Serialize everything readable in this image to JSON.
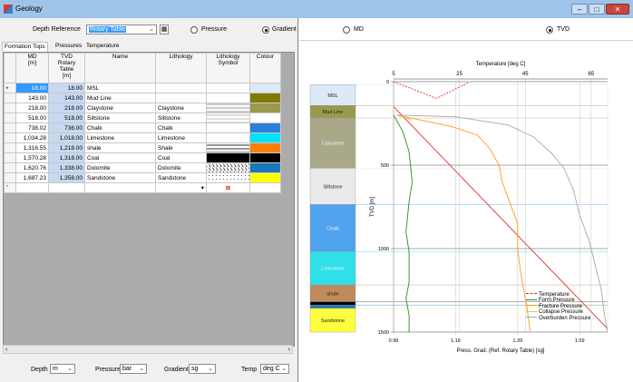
{
  "window": {
    "title": "Geology",
    "btn_min": "–",
    "btn_max": "□",
    "btn_close": "✕"
  },
  "toolbar": {
    "depth_ref_label": "Depth Reference",
    "depth_ref_value": "Rotary Table",
    "pressure_label": "Pressure",
    "gradient_label": "Gradient",
    "md_label": "MD",
    "tvd_label": "TVD"
  },
  "tabs": [
    "Formation Tops",
    "Pressures",
    "Temperature"
  ],
  "table": {
    "headers": [
      "MD\n[m]",
      "TVD\nRotary\nTable\n[m]",
      "Name",
      "Lithology",
      "Lithology\nSymbol",
      "Colour"
    ],
    "rows": [
      {
        "md": "18.00",
        "tvd": "18.00",
        "name": "MSL",
        "lith": "",
        "color": "#dbe9f8",
        "pattern": ""
      },
      {
        "md": "143.00",
        "tvd": "143.00",
        "name": "Mud Line",
        "lith": "",
        "color": "#807a00",
        "pattern": ""
      },
      {
        "md": "218.00",
        "tvd": "218.00",
        "name": "Claystone",
        "lith": "Claystone",
        "color": "#9a9a4c",
        "pattern": "clay"
      },
      {
        "md": "518.00",
        "tvd": "518.00",
        "name": "Siltstone",
        "lith": "Siltstone",
        "color": "#ffffff",
        "pattern": "silt"
      },
      {
        "md": "738.02",
        "tvd": "736.00",
        "name": "Chalk",
        "lith": "Chalk",
        "color": "#2c7fd8",
        "pattern": "chalk"
      },
      {
        "md": "1,034.28",
        "tvd": "1,018.00",
        "name": "Limestone",
        "lith": "Limestone",
        "color": "#00e0ff",
        "pattern": "lime"
      },
      {
        "md": "1,316.55",
        "tvd": "1,218.00",
        "name": "shale",
        "lith": "Shale",
        "color": "#ff8000",
        "pattern": "shale"
      },
      {
        "md": "1,570.28",
        "tvd": "1,318.00",
        "name": "Coal",
        "lith": "Coal",
        "color": "#000000",
        "pattern": "coal"
      },
      {
        "md": "1,620.76",
        "tvd": "1,338.00",
        "name": "Dolomite",
        "lith": "Dolomite",
        "color": "#1878b8",
        "pattern": "dolo"
      },
      {
        "md": "1,687.23",
        "tvd": "1,358.00",
        "name": "Sandstone",
        "lith": "Sandstone",
        "color": "#ffff00",
        "pattern": "sand"
      }
    ],
    "new_row_marker": "*",
    "current_row_marker": "▸"
  },
  "units": {
    "depth_label": "Depth",
    "depth_value": "m",
    "pressure_label": "Pressure",
    "pressure_value": "bar",
    "gradient_label": "Gradient",
    "gradient_value": "sg",
    "temp_label": "Temp",
    "temp_value": "deg C"
  },
  "chart_data": {
    "type": "line",
    "top_axis_label": "Temperature [deg C]",
    "top_ticks": [
      "5",
      "25",
      "45",
      "65"
    ],
    "top_range": [
      5,
      70
    ],
    "xlabel": "Press. Grad. (Ref. Rotary Table) [sg]",
    "x_ticks": [
      "0.99",
      "1.19",
      "1.39",
      "1.59"
    ],
    "x_range": [
      0.99,
      1.68
    ],
    "ylabel": "TVD [m]",
    "y_ticks": [
      "0",
      "500",
      "1000",
      "1500"
    ],
    "y_range": [
      0,
      1500
    ],
    "legend": [
      "Temperature",
      "Form.Pressure",
      "Fracture Pressure",
      "Collapse Pressure",
      "Overburden Pressure"
    ],
    "formations": [
      {
        "name": "MSL",
        "top": 18,
        "base": 143,
        "color": "#dbe9f8",
        "label": true
      },
      {
        "name": "Mud Line",
        "top": 143,
        "base": 218,
        "color": "#9a9a4c",
        "label": true
      },
      {
        "name": "Claystone",
        "top": 218,
        "base": 518,
        "color": "#a9a98a",
        "label": true
      },
      {
        "name": "Siltstone",
        "top": 518,
        "base": 736,
        "color": "#eaeaea",
        "label": true
      },
      {
        "name": "Chalk",
        "top": 736,
        "base": 1018,
        "color": "#4fa3ef",
        "label": true
      },
      {
        "name": "Limestone",
        "top": 1018,
        "base": 1218,
        "color": "#2fe0e8",
        "label": true
      },
      {
        "name": "shale",
        "top": 1218,
        "base": 1318,
        "color": "#c08a5a",
        "label": true
      },
      {
        "name": "Coal",
        "top": 1318,
        "base": 1338,
        "color": "#000000",
        "label": false
      },
      {
        "name": "Dolomite",
        "top": 1338,
        "base": 1358,
        "color": "#1878b8",
        "label": false
      },
      {
        "name": "Sandstone",
        "top": 1358,
        "base": 1500,
        "color": "#ffff40",
        "label": true
      }
    ],
    "series": [
      {
        "name": "Temperature",
        "color": "#e8302a",
        "dash": true,
        "axis": "top",
        "x": [
          5,
          18,
          28
        ],
        "y": [
          0,
          100,
          3
        ]
      },
      {
        "name": "Temperature (gradient)",
        "color": "#e8302a",
        "dash": false,
        "axis": "top",
        "x": [
          5,
          70
        ],
        "y": [
          150,
          1480
        ]
      },
      {
        "name": "Form.Pressure",
        "color": "#2a8a2a",
        "dash": false,
        "axis": "bottom",
        "x": [
          0.99,
          1.02,
          1.04,
          1.05,
          1.04,
          1.03,
          1.04,
          1.04,
          1.03,
          1.04,
          1.04
        ],
        "y": [
          200,
          300,
          420,
          600,
          720,
          900,
          1020,
          1200,
          1300,
          1400,
          1500
        ]
      },
      {
        "name": "Fracture Pressure",
        "color": "#ff9a1a",
        "dash": false,
        "axis": "bottom",
        "x": [
          1.0,
          1.18,
          1.26,
          1.3,
          1.33,
          1.34,
          1.36,
          1.39,
          1.39,
          1.4,
          1.42,
          1.43
        ],
        "y": [
          200,
          270,
          320,
          400,
          500,
          600,
          700,
          850,
          1000,
          1150,
          1350,
          1500
        ]
      },
      {
        "name": "Collapse Pressure",
        "color": "#d8c870",
        "dash": false,
        "axis": "bottom",
        "x": [
          1.0,
          1.05
        ],
        "y": [
          200,
          230
        ]
      },
      {
        "name": "Overburden Pressure",
        "color": "#a8a8a8",
        "dash": false,
        "axis": "bottom",
        "x": [
          1.0,
          1.19,
          1.36,
          1.44,
          1.5,
          1.54,
          1.57,
          1.59,
          1.62,
          1.64,
          1.66,
          1.67,
          1.68
        ],
        "y": [
          200,
          210,
          260,
          330,
          430,
          520,
          650,
          800,
          950,
          1100,
          1250,
          1400,
          1500
        ]
      }
    ],
    "grid": true,
    "legend_position": "bottom-right"
  }
}
